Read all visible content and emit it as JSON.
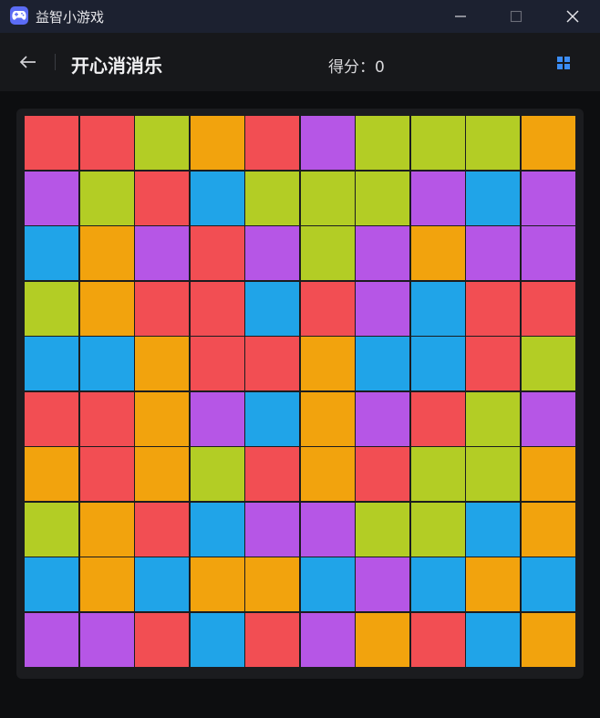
{
  "window": {
    "app_title": "益智小游戏",
    "app_icon": "gamepad-icon"
  },
  "toolbar": {
    "back_icon": "arrow-left-icon",
    "title": "开心消消乐",
    "score_text": "得分：0",
    "menu_icon": "grid-icon"
  },
  "colors": {
    "R": "#f24e53",
    "G": "#b3cd25",
    "O": "#f2a30d",
    "P": "#b656e6",
    "B": "#20a4e8",
    "accent": "#3b8cf5"
  },
  "board": {
    "rows": 10,
    "cols": 10,
    "tiles": [
      [
        "R",
        "R",
        "G",
        "O",
        "R",
        "P",
        "G",
        "G",
        "G",
        "O"
      ],
      [
        "P",
        "G",
        "R",
        "B",
        "G",
        "G",
        "G",
        "P",
        "B",
        "P"
      ],
      [
        "B",
        "O",
        "P",
        "R",
        "P",
        "G",
        "P",
        "O",
        "P",
        "P"
      ],
      [
        "G",
        "O",
        "R",
        "R",
        "B",
        "R",
        "P",
        "B",
        "R",
        "R"
      ],
      [
        "B",
        "B",
        "O",
        "R",
        "R",
        "O",
        "B",
        "B",
        "R",
        "G"
      ],
      [
        "R",
        "R",
        "O",
        "P",
        "B",
        "O",
        "P",
        "R",
        "G",
        "P"
      ],
      [
        "O",
        "R",
        "O",
        "G",
        "R",
        "O",
        "R",
        "G",
        "G",
        "O"
      ],
      [
        "G",
        "O",
        "R",
        "B",
        "P",
        "P",
        "G",
        "G",
        "B",
        "O"
      ],
      [
        "B",
        "O",
        "B",
        "O",
        "O",
        "B",
        "P",
        "B",
        "O",
        "B"
      ],
      [
        "P",
        "P",
        "R",
        "B",
        "R",
        "P",
        "O",
        "R",
        "B",
        "O"
      ]
    ]
  }
}
